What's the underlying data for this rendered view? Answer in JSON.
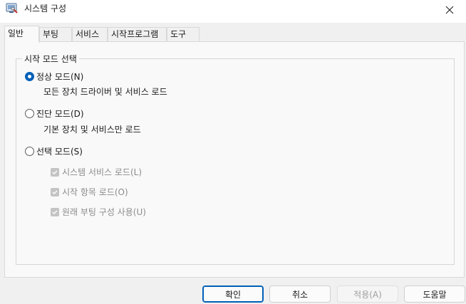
{
  "window": {
    "title": "시스템 구성"
  },
  "tabs": [
    {
      "label": "일반"
    },
    {
      "label": "부팅"
    },
    {
      "label": "서비스"
    },
    {
      "label": "시작프로그램"
    },
    {
      "label": "도구"
    }
  ],
  "startup_group": {
    "title": "시작 모드 선택",
    "normal": {
      "label": "정상 모드(N)",
      "desc": "모든 장치 드라이버 및 서비스 로드",
      "selected": true
    },
    "diagnostic": {
      "label": "진단 모드(D)",
      "desc": "기본 장치 및 서비스만 로드",
      "selected": false
    },
    "selective": {
      "label": "선택 모드(S)",
      "selected": false,
      "options": [
        {
          "label": "시스템 서비스 로드(L)",
          "checked": true
        },
        {
          "label": "시작 항목 로드(O)",
          "checked": true
        },
        {
          "label": "원래 부팅 구성 사용(U)",
          "checked": true
        }
      ]
    }
  },
  "buttons": {
    "ok": "확인",
    "cancel": "취소",
    "apply": "적용(A)",
    "help": "도움말"
  },
  "colors": {
    "accent": "#005fb8"
  },
  "icons": {
    "app": "system-config-icon",
    "close": "close-icon"
  }
}
